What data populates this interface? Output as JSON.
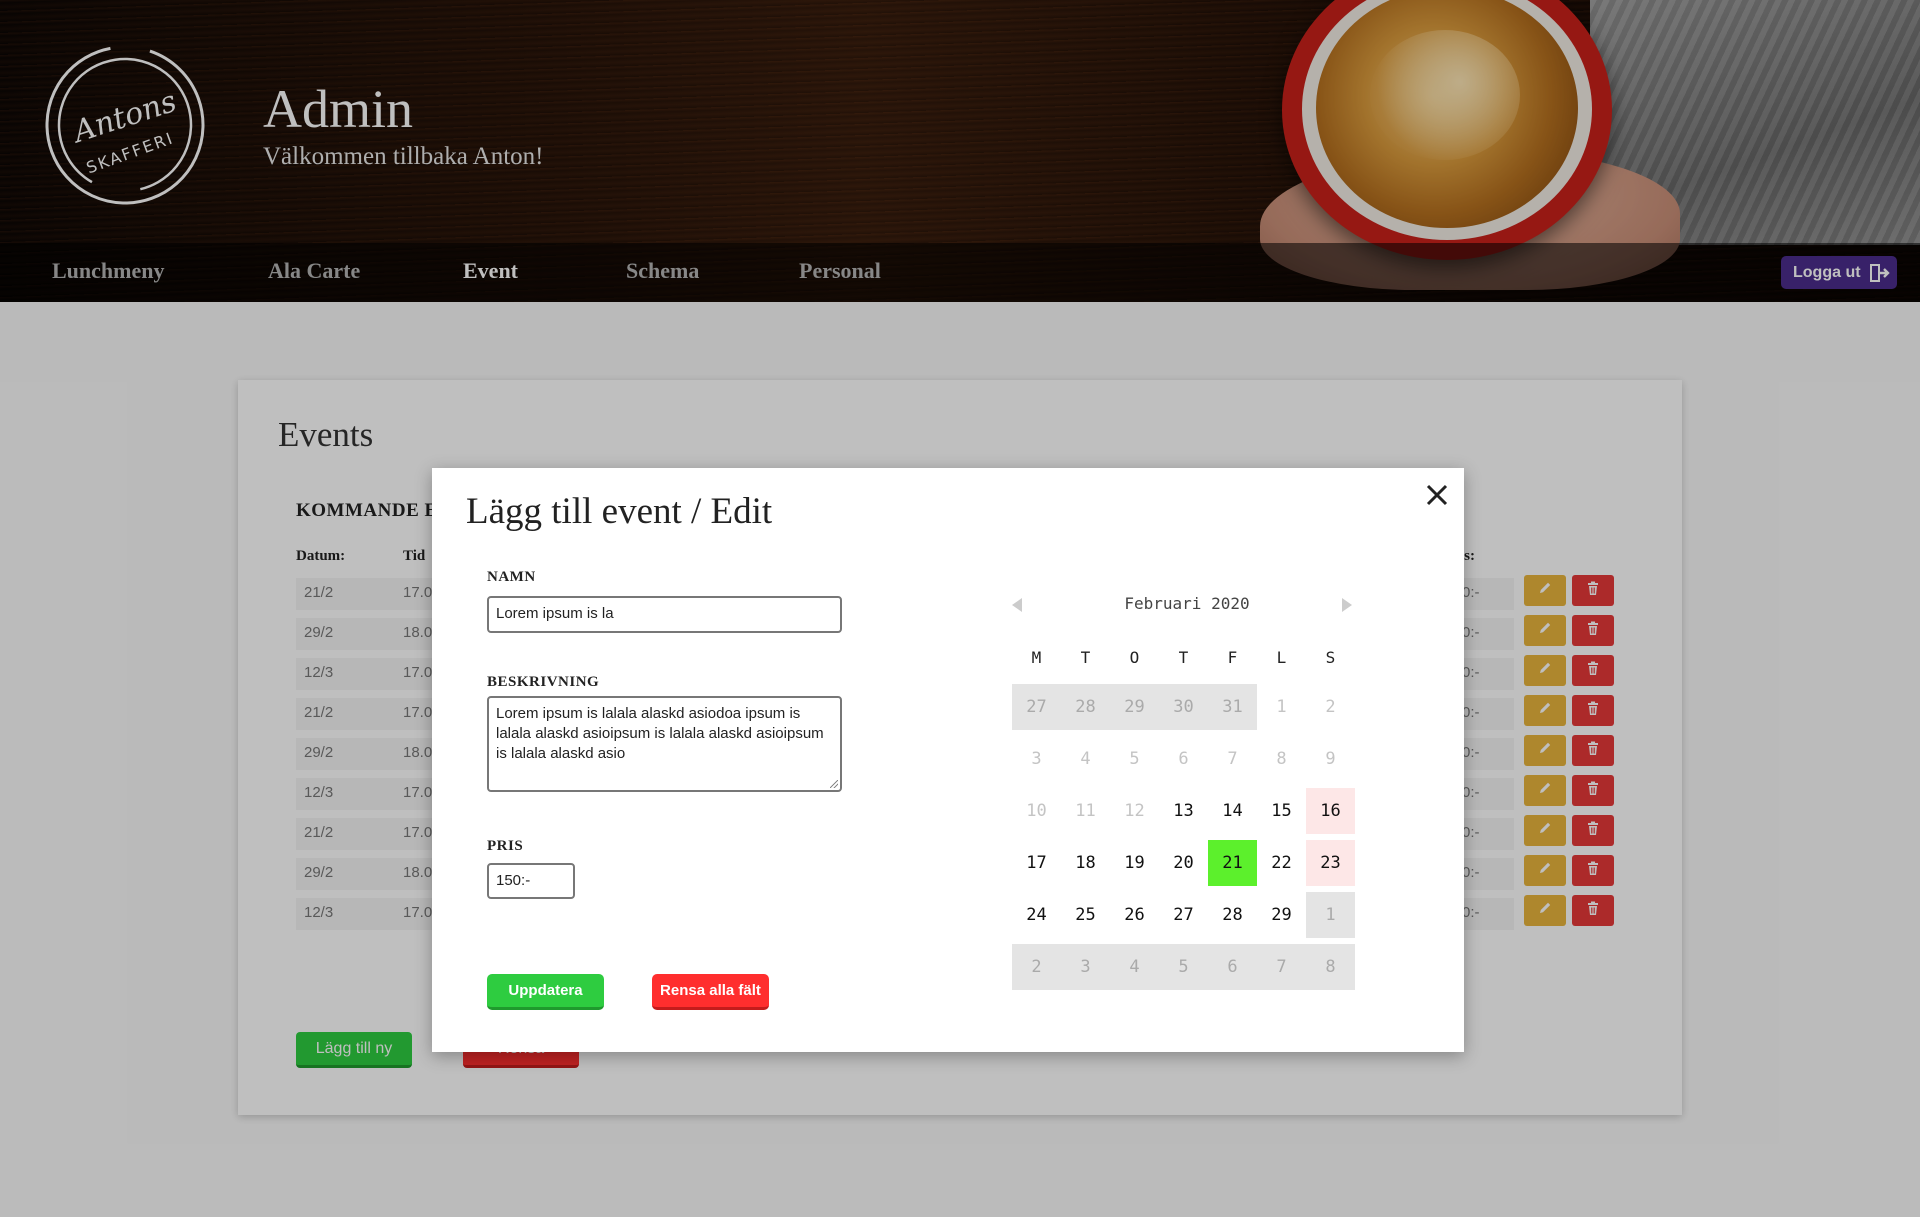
{
  "header": {
    "logo_text_top": "Antons",
    "logo_text_bottom": "SKAFFERI",
    "title": "Admin",
    "welcome": "Välkommen tillbaka Anton!"
  },
  "nav": {
    "items": [
      {
        "label": "Lunchmeny",
        "active": false
      },
      {
        "label": "Ala Carte",
        "active": false
      },
      {
        "label": "Event",
        "active": true
      },
      {
        "label": "Schema",
        "active": false
      },
      {
        "label": "Personal",
        "active": false
      }
    ],
    "logout_label": "Logga ut",
    "logout_icon": "door-exit-icon"
  },
  "events_panel": {
    "title": "Events",
    "section_label": "KOMMANDE E",
    "col_date": "Datum:",
    "col_time": "Tid",
    "col_price": "is:",
    "rows": [
      {
        "date": "21/2",
        "time": "17.0",
        "price": "0:-"
      },
      {
        "date": "29/2",
        "time": "18.0",
        "price": "0:-"
      },
      {
        "date": "12/3",
        "time": "17.0",
        "price": "0:-"
      },
      {
        "date": "21/2",
        "time": "17.0",
        "price": "0:-"
      },
      {
        "date": "29/2",
        "time": "18.0",
        "price": "0:-"
      },
      {
        "date": "12/3",
        "time": "17.0",
        "price": "0:-"
      },
      {
        "date": "21/2",
        "time": "17.0",
        "price": "0:-"
      },
      {
        "date": "29/2",
        "time": "18.0",
        "price": "0:-"
      },
      {
        "date": "12/3",
        "time": "17.0",
        "price": "0:-"
      }
    ],
    "edit_icon": "pencil-icon",
    "delete_icon": "trash-icon",
    "add_button": "Lägg till ny",
    "clear_button": "Rensa"
  },
  "modal": {
    "title": "Lägg till event / Edit",
    "name_label": "NAMN",
    "name_value": "Lorem ipsum is la",
    "desc_label": "BESKRIVNING",
    "desc_value": "Lorem ipsum is lalala alaskd asiodoa ipsum is lalala alaskd asioipsum is lalala alaskd asioipsum is lalala alaskd asio",
    "price_label": "PRIS",
    "price_value": "150:-",
    "update_button": "Uppdatera",
    "clear_button": "Rensa alla fält",
    "close_icon": "close-icon",
    "colors": {
      "update": "#2ecc40",
      "clear": "#ff2e2e"
    }
  },
  "calendar": {
    "month_label": "Februari 2020",
    "weekdays": [
      "M",
      "T",
      "O",
      "T",
      "F",
      "L",
      "S"
    ],
    "selected_color": "#5cf02c",
    "weeks": [
      [
        {
          "d": "27",
          "s": "out-gray"
        },
        {
          "d": "28",
          "s": "out-gray"
        },
        {
          "d": "29",
          "s": "out-gray"
        },
        {
          "d": "30",
          "s": "out-gray"
        },
        {
          "d": "31",
          "s": "out-gray"
        },
        {
          "d": "1",
          "s": "past"
        },
        {
          "d": "2",
          "s": "past"
        }
      ],
      [
        {
          "d": "3",
          "s": "past"
        },
        {
          "d": "4",
          "s": "past"
        },
        {
          "d": "5",
          "s": "past"
        },
        {
          "d": "6",
          "s": "past"
        },
        {
          "d": "7",
          "s": "past"
        },
        {
          "d": "8",
          "s": "past"
        },
        {
          "d": "9",
          "s": "past"
        }
      ],
      [
        {
          "d": "10",
          "s": "past"
        },
        {
          "d": "11",
          "s": "past"
        },
        {
          "d": "12",
          "s": "past"
        },
        {
          "d": "13",
          "s": "normal"
        },
        {
          "d": "14",
          "s": "normal"
        },
        {
          "d": "15",
          "s": "normal"
        },
        {
          "d": "16",
          "s": "weekend"
        }
      ],
      [
        {
          "d": "17",
          "s": "normal"
        },
        {
          "d": "18",
          "s": "normal"
        },
        {
          "d": "19",
          "s": "normal"
        },
        {
          "d": "20",
          "s": "normal"
        },
        {
          "d": "21",
          "s": "selected"
        },
        {
          "d": "22",
          "s": "normal"
        },
        {
          "d": "23",
          "s": "weekend"
        }
      ],
      [
        {
          "d": "24",
          "s": "normal"
        },
        {
          "d": "25",
          "s": "normal"
        },
        {
          "d": "26",
          "s": "normal"
        },
        {
          "d": "27",
          "s": "normal"
        },
        {
          "d": "28",
          "s": "normal"
        },
        {
          "d": "29",
          "s": "normal"
        },
        {
          "d": "1",
          "s": "out-gray"
        }
      ],
      [
        {
          "d": "2",
          "s": "out-gray"
        },
        {
          "d": "3",
          "s": "out-gray"
        },
        {
          "d": "4",
          "s": "out-gray"
        },
        {
          "d": "5",
          "s": "out-gray"
        },
        {
          "d": "6",
          "s": "out-gray"
        },
        {
          "d": "7",
          "s": "out-gray"
        },
        {
          "d": "8",
          "s": "out-gray"
        }
      ]
    ]
  }
}
